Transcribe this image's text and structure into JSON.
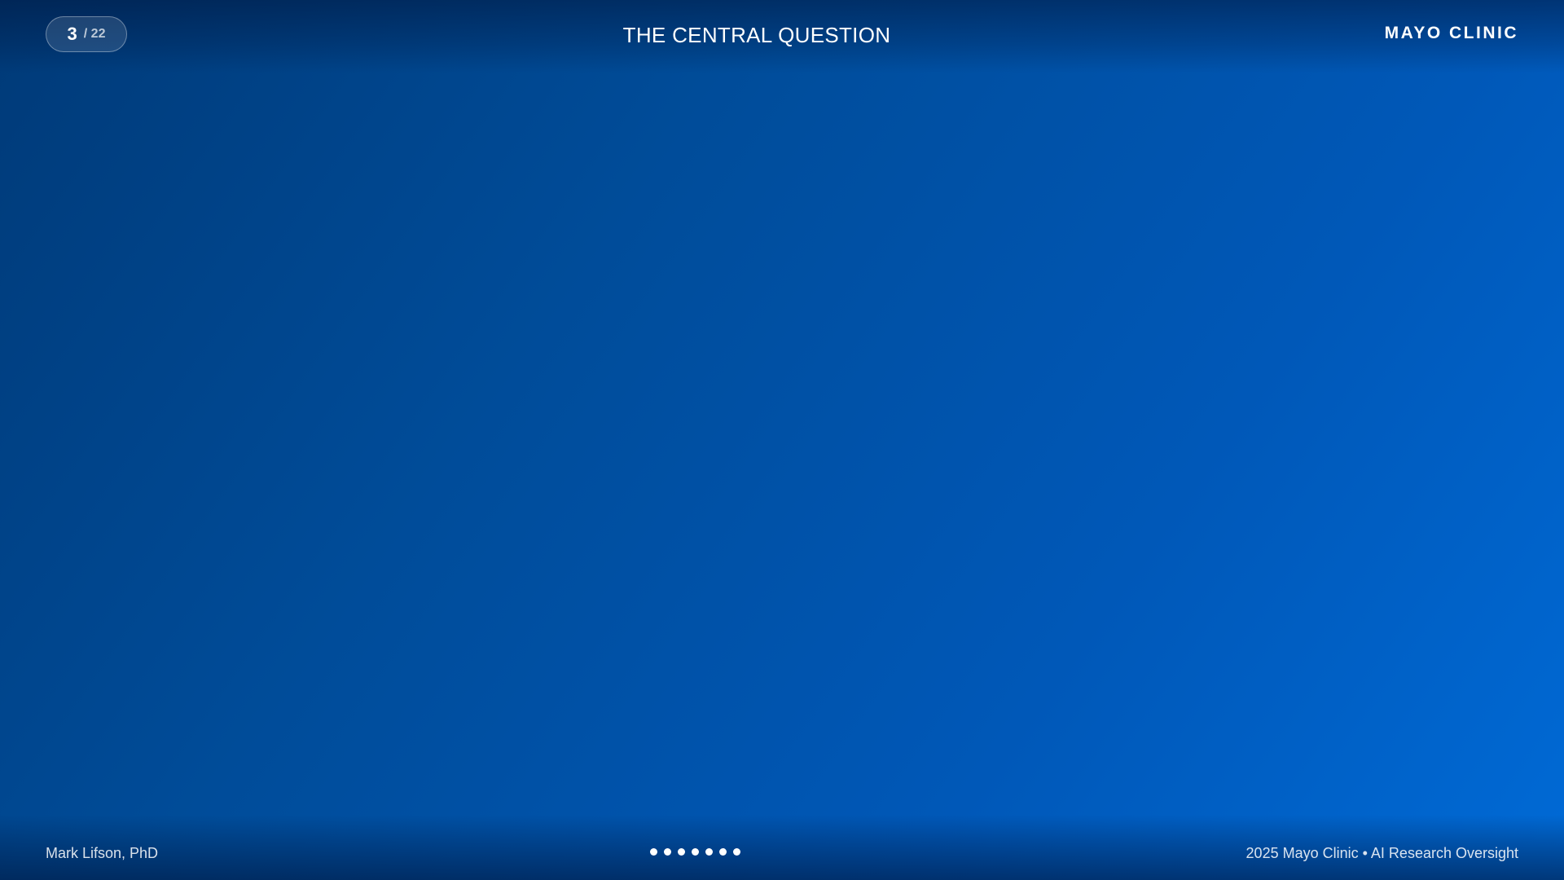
{
  "header": {
    "slide_current": "3",
    "slide_total": "/ 22",
    "title": "THE CENTRAL QUESTION",
    "brand": "MAYO CLINIC"
  },
  "footer": {
    "presenter": "Mark Lifson, PhD",
    "right_text": "2025 Mayo Clinic • AI Research Oversight",
    "nav_dots_count": 7
  },
  "colors": {
    "background_start": "#003a78",
    "background_end": "#006ad6",
    "text": "#ffffff"
  }
}
